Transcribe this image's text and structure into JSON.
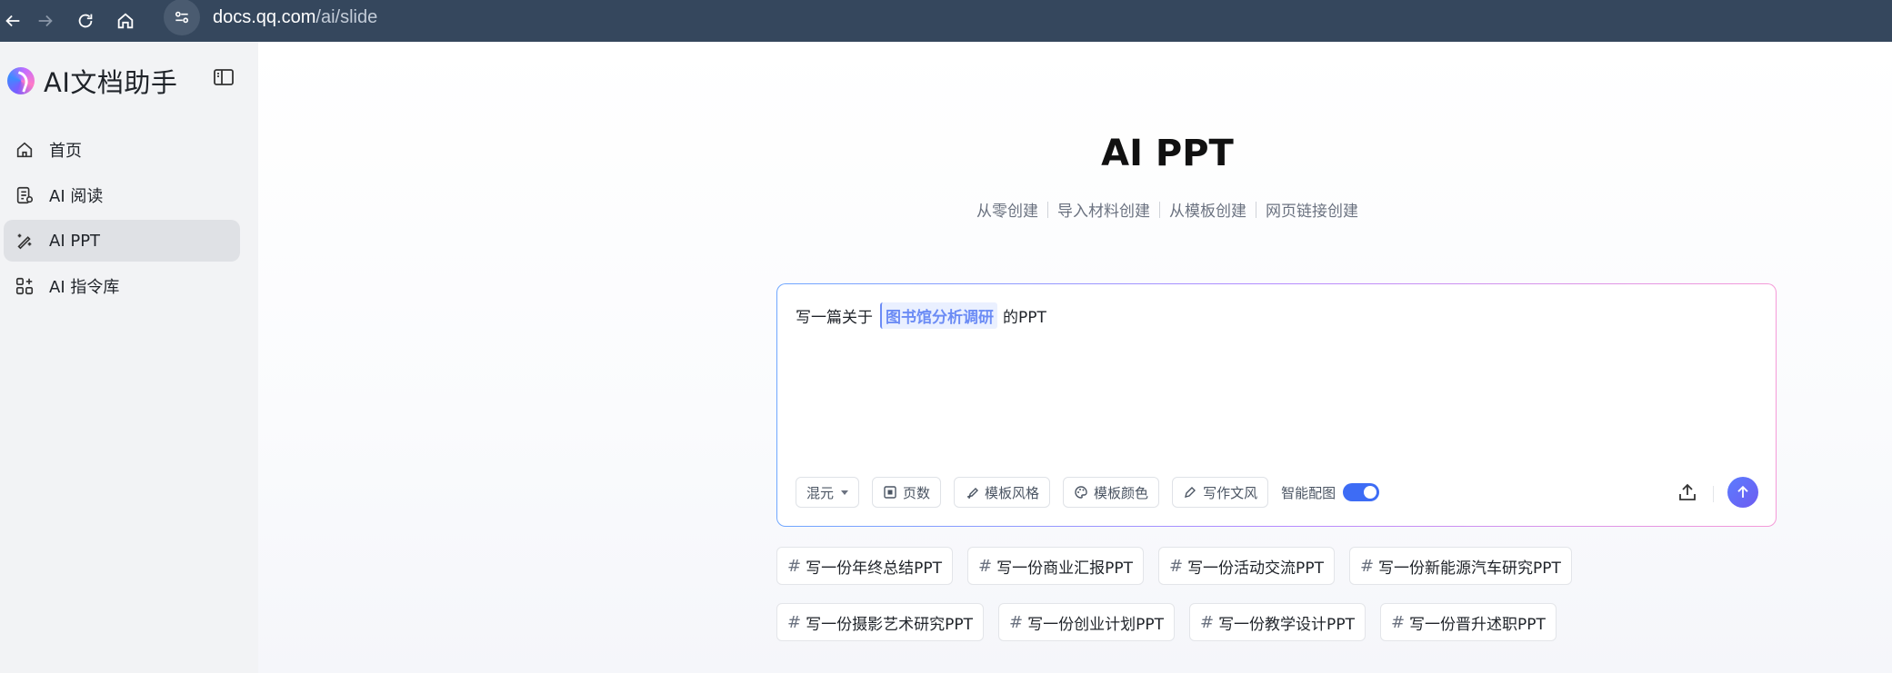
{
  "browser": {
    "url_host": "docs.qq.com",
    "url_path": "/ai/slide"
  },
  "sidebar": {
    "brand_title": "AI文档助手",
    "items": [
      {
        "label": "首页",
        "icon": "home-icon",
        "active": false
      },
      {
        "label": "AI 阅读",
        "icon": "document-read-icon",
        "active": false
      },
      {
        "label": "AI PPT",
        "icon": "magic-wand-icon",
        "active": true
      },
      {
        "label": "AI 指令库",
        "icon": "apps-grid-icon",
        "active": false
      }
    ]
  },
  "main": {
    "title": "AI PPT",
    "modes": [
      "从零创建",
      "导入材料创建",
      "从模板创建",
      "网页链接创建"
    ],
    "prompt": {
      "prefix": "写一篇关于",
      "slot": "图书馆分析调研",
      "suffix": "的PPT"
    },
    "toolbar": {
      "model": "混元",
      "pages": "页数",
      "template_style": "模板风格",
      "template_color": "模板颜色",
      "writing_style": "写作文风",
      "smart_image_label": "智能配图",
      "smart_image_on": true
    },
    "suggestions": [
      [
        "写一份年终总结PPT",
        "写一份商业汇报PPT",
        "写一份活动交流PPT",
        "写一份新能源汽车研究PPT"
      ],
      [
        "写一份摄影艺术研究PPT",
        "写一份创业计划PPT",
        "写一份教学设计PPT",
        "写一份晋升述职PPT"
      ]
    ]
  },
  "colors": {
    "browser_bar": "#35475d",
    "accent": "#3d6cf5",
    "sidebar_bg": "#f2f3f5",
    "active_item": "#dfe1e5"
  }
}
